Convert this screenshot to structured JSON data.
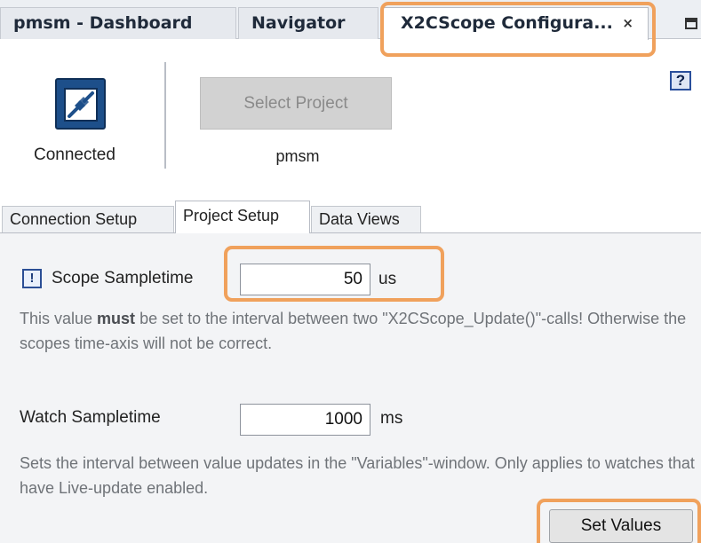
{
  "tabs": [
    {
      "label": "pmsm - Dashboard"
    },
    {
      "label": "Navigator"
    },
    {
      "label": "X2CScope Configura...",
      "close_glyph": "×"
    }
  ],
  "header": {
    "connection_status": "Connected",
    "connection_icon": "plug-connected-icon",
    "select_project_label": "Select Project",
    "project_name": "pmsm",
    "help_glyph": "?"
  },
  "subtabs": [
    {
      "label": "Connection Setup"
    },
    {
      "label": "Project Setup"
    },
    {
      "label": "Data Views"
    }
  ],
  "project_setup": {
    "scope": {
      "warning_glyph": "!",
      "label": "Scope Sampletime",
      "value": "50",
      "unit": "us",
      "hint_pre": "This value ",
      "hint_bold": "must",
      "hint_post": " be set to the interval between two \"X2CScope_Update()\"-calls! Otherwise the scopes time-axis will not be correct."
    },
    "watch": {
      "label": "Watch Sampletime",
      "value": "1000",
      "unit": "ms",
      "hint": "Sets the interval between value updates in the \"Variables\"-window. Only applies to watches that have Live-update enabled."
    },
    "set_values_label": "Set Values"
  },
  "colors": {
    "highlight": "#f0a15c",
    "icon_blue": "#1d4f8a",
    "disabled_button": "#d2d2d2"
  }
}
